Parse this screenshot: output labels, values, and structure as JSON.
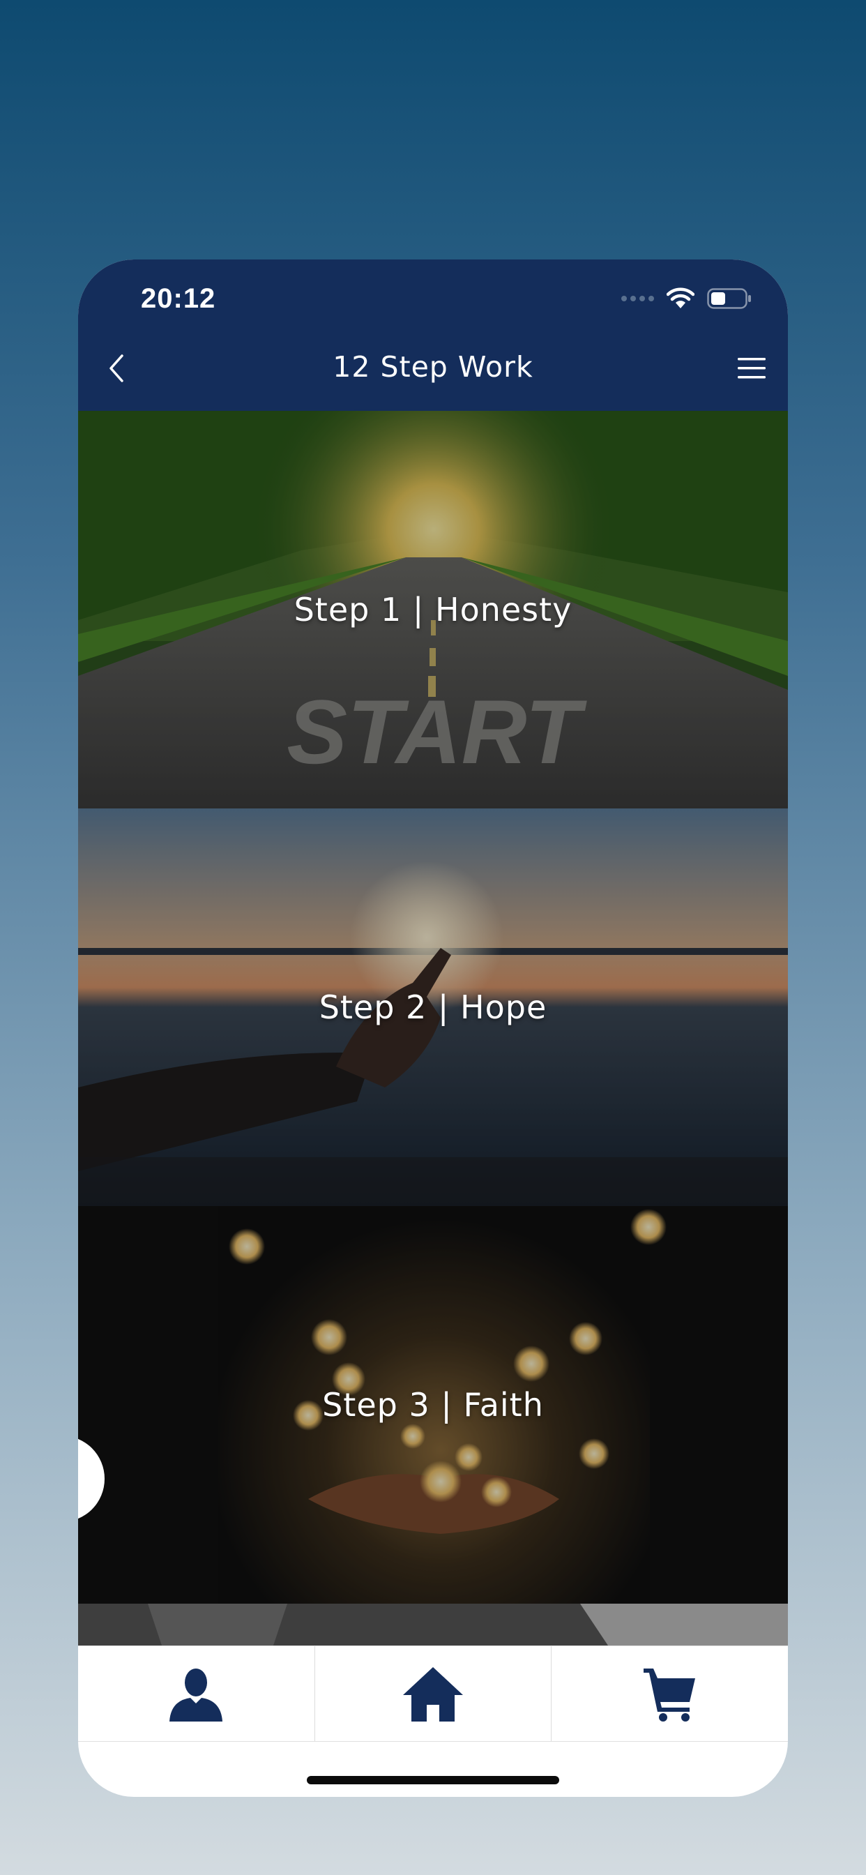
{
  "status_bar": {
    "time": "20:12"
  },
  "header": {
    "title": "12 Step Work",
    "back_icon": "chevron-left-icon",
    "menu_icon": "hamburger-menu-icon"
  },
  "steps": [
    {
      "label": "Step 1 | Honesty",
      "image_text": "START"
    },
    {
      "label": "Step 2 | Hope"
    },
    {
      "label": "Step 3 | Faith"
    }
  ],
  "tab_bar": {
    "items": [
      {
        "icon": "user-icon"
      },
      {
        "icon": "home-icon"
      },
      {
        "icon": "cart-icon"
      }
    ]
  },
  "colors": {
    "header_bg": "#142d5b",
    "icon_color": "#142d5b",
    "tab_bg": "#ffffff"
  }
}
